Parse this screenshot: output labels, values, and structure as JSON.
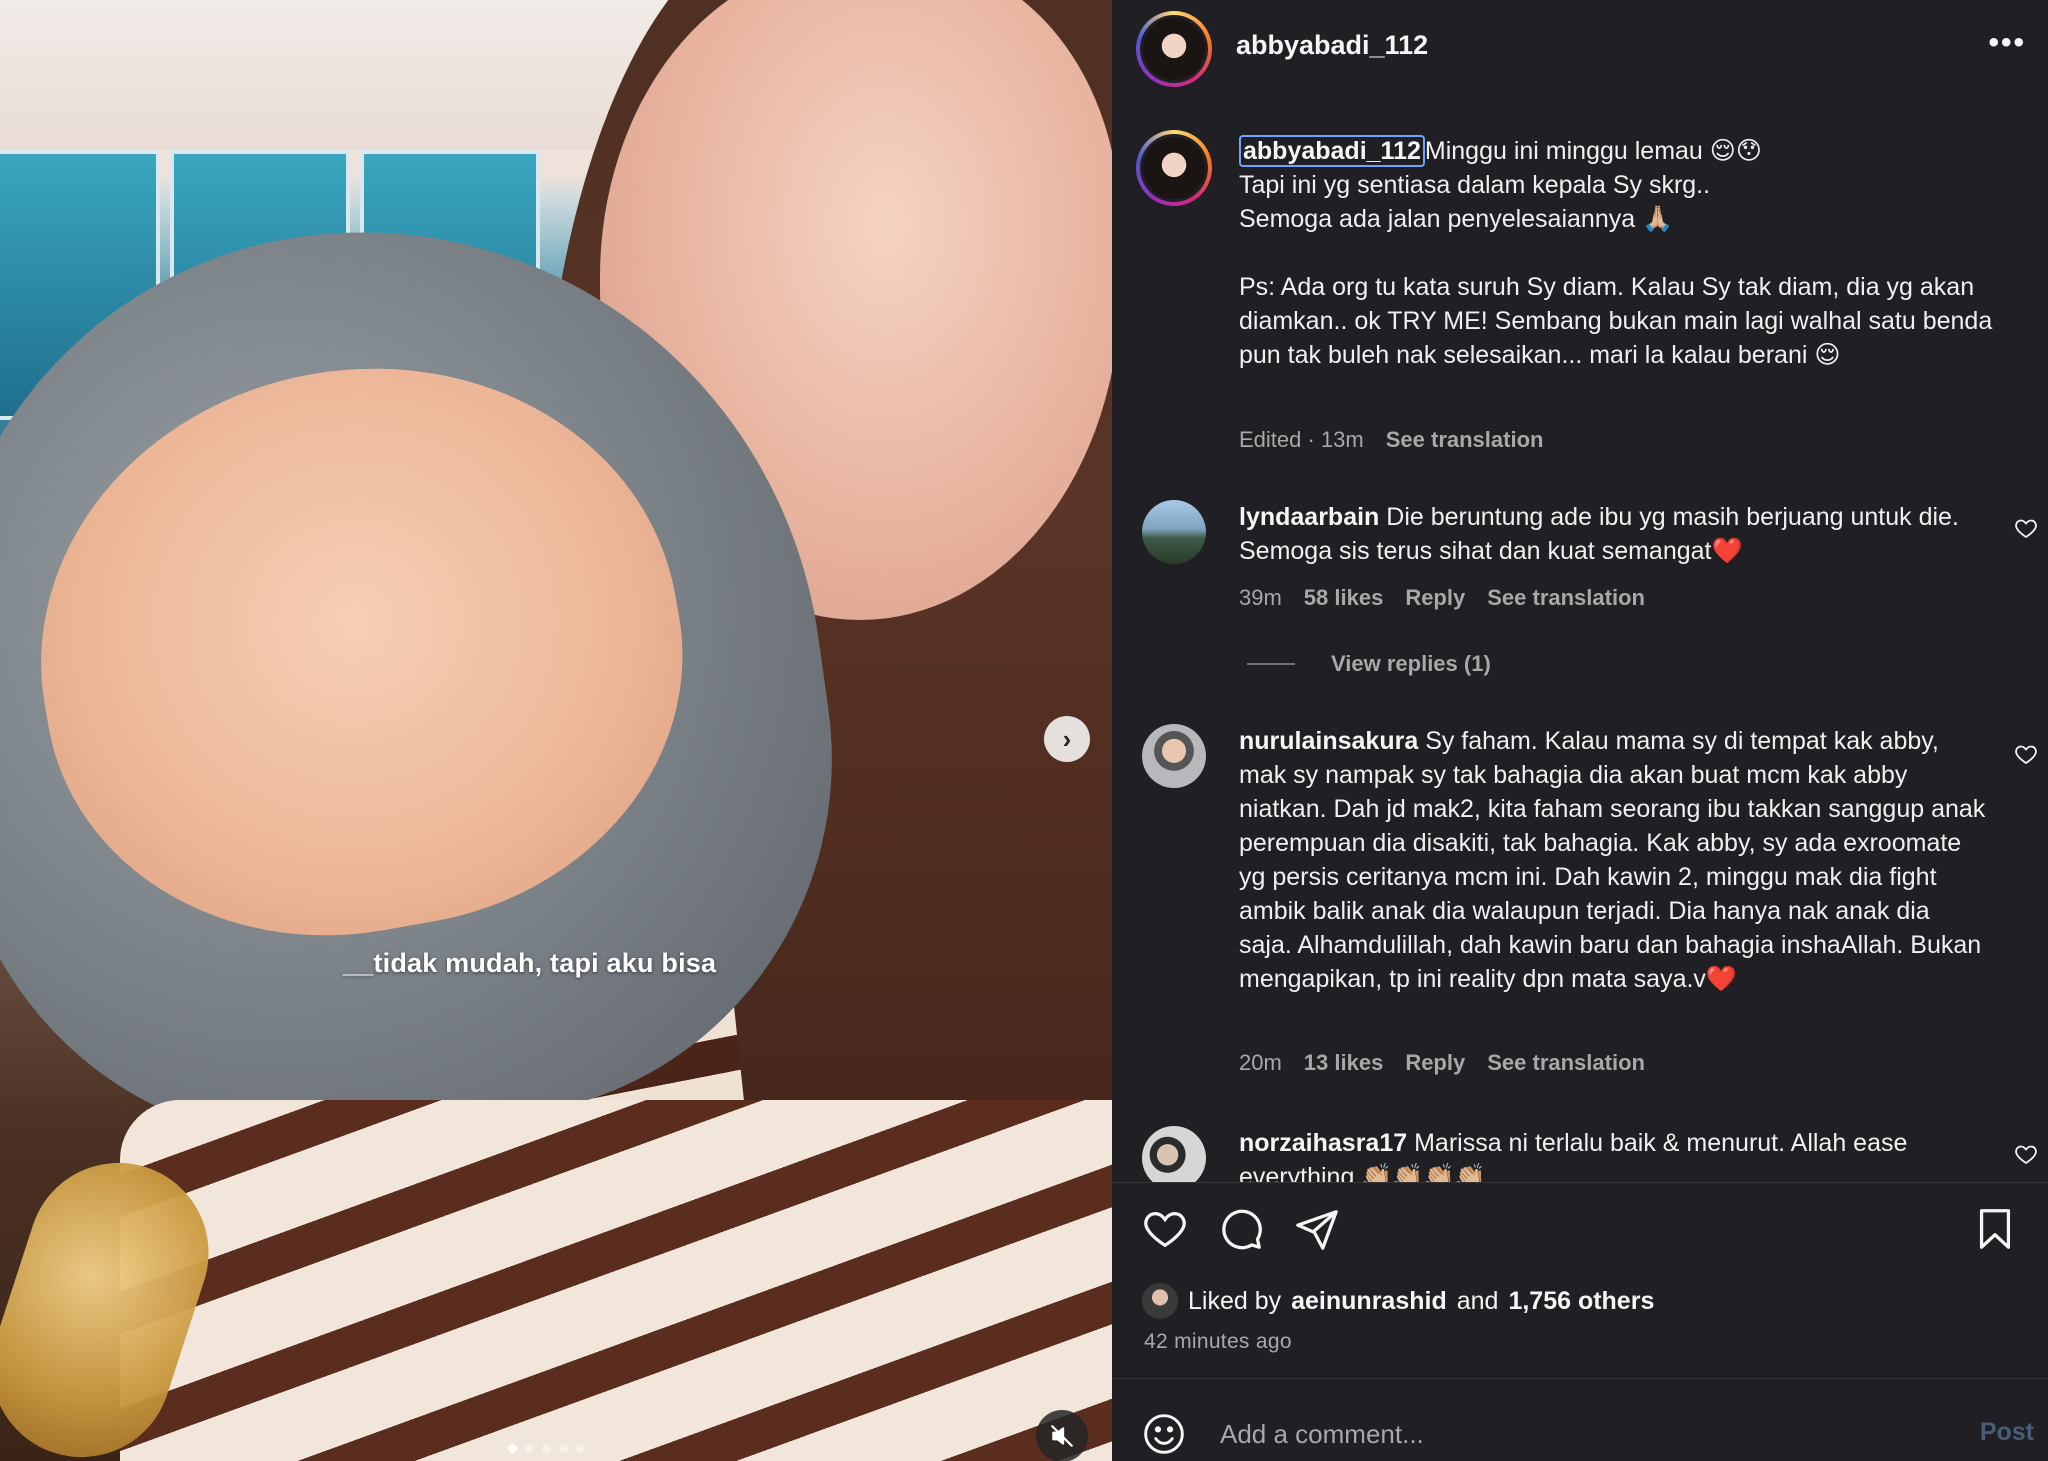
{
  "media": {
    "overlay_caption": "__tidak mudah, tapi aku bisa",
    "next_glyph": "›",
    "carousel_count": 5,
    "carousel_active": 0
  },
  "post_header": {
    "username": "abbyabadi_112",
    "more_glyph": "•••"
  },
  "caption": {
    "username": "abbyabadi_112",
    "line1": "Minggu ini minggu lemau 😌😯",
    "line2": "Tapi ini yg sentiasa dalam kepala Sy skrg..",
    "line3": "Semoga ada jalan penyelesaiannya 🙏🏼",
    "line4": "Ps: Ada org tu kata suruh Sy diam. Kalau Sy tak diam, dia yg akan diamkan.. ok TRY ME! Sembang bukan main lagi walhal satu benda pun tak buleh nak selesaikan... mari la kalau berani 😌",
    "edited": "Edited · 13m",
    "see_translation": "See translation"
  },
  "comments": [
    {
      "username": "lyndaarbain",
      "text": "Die beruntung ade ibu yg masih berjuang untuk die. Semoga sis terus sihat dan kuat semangat❤️",
      "time": "39m",
      "likes": "58 likes",
      "reply": "Reply",
      "see_translation": "See translation",
      "view_replies": "View replies (1)"
    },
    {
      "username": "nurulainsakura",
      "text": "Sy faham. Kalau mama sy di tempat kak abby, mak sy nampak sy tak bahagia dia akan buat mcm kak abby niatkan. Dah jd mak2, kita faham seorang ibu takkan sanggup anak perempuan dia disakiti, tak bahagia. Kak abby, sy ada exroomate yg persis ceritanya mcm ini. Dah kawin 2, minggu mak dia fight ambik balik anak dia walaupun terjadi. Dia hanya nak anak dia saja. Alhamdulillah, dah kawin baru dan bahagia inshaAllah. Bukan mengapikan, tp ini reality dpn mata saya.v❤️",
      "time": "20m",
      "likes": "13 likes",
      "reply": "Reply",
      "see_translation": "See translation"
    },
    {
      "username": "norzaihasra17",
      "text": "Marissa ni terlalu baik & menurut. Allah ease everything 👏🏼👏🏼👏🏼👏🏼"
    }
  ],
  "likes": {
    "prefix": "Liked by",
    "user": "aeinunrashid",
    "and": "and",
    "others": "1,756 others",
    "time_ago": "42 minutes ago"
  },
  "add_comment": {
    "placeholder": "Add a comment...",
    "post_label": "Post"
  },
  "colors": {
    "panel_bg": "#1f1f24",
    "mention_border": "#6fa3ff",
    "muted_text": "#a8a8a8",
    "post_disabled": "#4a5d78"
  }
}
